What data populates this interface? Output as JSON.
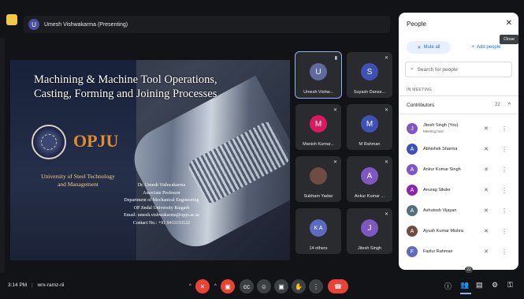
{
  "presenter": {
    "initial": "U",
    "label": "Umesh Vishwakarma (Presenting)"
  },
  "slide": {
    "title_line1": "Machining & Machine Tool Operations,",
    "title_line2": "Casting, Forming and Joining Processes",
    "logo_text": "OPJU",
    "university_line1": "University of Steel Technology",
    "university_line2": "and Management",
    "contact_lines": [
      "Dr. Umesh Vishwakarma",
      "Associate Professor",
      "Department of Mechanical Engineering",
      "OP Jindal University Raigarh",
      "Email: umesh.vishwakarma@opju.ac.in",
      "Contact No.: +91 9411153122"
    ]
  },
  "tiles": [
    {
      "initial": "U",
      "name": "Umesh Vishw...",
      "color": "#5f6a9e"
    },
    {
      "initial": "S",
      "name": "Suyash Danse...",
      "color": "#3f51b5"
    },
    {
      "initial": "M",
      "name": "Manish Kumar...",
      "color": "#d81b60"
    },
    {
      "initial": "M",
      "name": "M Rahman",
      "color": "#3f51b5"
    },
    {
      "initial": "",
      "name": "Subham Yadav",
      "color": "#6d4c41"
    },
    {
      "initial": "A",
      "name": "Ankur Kumar ...",
      "color": "#7e57c2"
    },
    {
      "initial": "K A",
      "name": "14 others",
      "color": "#5c6bc0"
    },
    {
      "initial": "J",
      "name": "Jitesh Singh",
      "color": "#7e57c2"
    }
  ],
  "people_panel": {
    "title": "People",
    "close_tooltip": "Close",
    "mute_all": "Mute all",
    "add_people": "Add people",
    "search_placeholder": "Search for people",
    "section": "IN MEETING",
    "group": "Contributors",
    "count": "22",
    "people": [
      {
        "initial": "J",
        "name": "Jitesh Singh (You)",
        "sub": "Meeting host",
        "color": "#7e57c2"
      },
      {
        "initial": "A",
        "name": "Abhishek Sharma",
        "sub": "",
        "color": "#3f51b5"
      },
      {
        "initial": "A",
        "name": "Ankur Kumar Singh",
        "sub": "",
        "color": "#7e57c2"
      },
      {
        "initial": "A",
        "name": "Anurag Sikder",
        "sub": "",
        "color": "#8e24aa"
      },
      {
        "initial": "A",
        "name": "Ashutosh Vijayan",
        "sub": "",
        "color": "#546e7a"
      },
      {
        "initial": "A",
        "name": "Ayush Kumar Mishra",
        "sub": "",
        "color": "#6d4c41"
      },
      {
        "initial": "F",
        "name": "Fazlur Rahman",
        "sub": "",
        "color": "#5c6bc0"
      }
    ]
  },
  "bottom": {
    "time": "3:14 PM",
    "separator": "|",
    "meeting_code": "wrx-ramz-rii",
    "participants_badge": "22"
  },
  "icons": {
    "mic": "mic-off-icon",
    "cam": "camera-off-icon",
    "cc": "captions-icon",
    "emoji": "emoji-icon",
    "present": "present-icon",
    "hand": "raise-hand-icon",
    "more": "more-icon",
    "end": "end-call-icon"
  }
}
